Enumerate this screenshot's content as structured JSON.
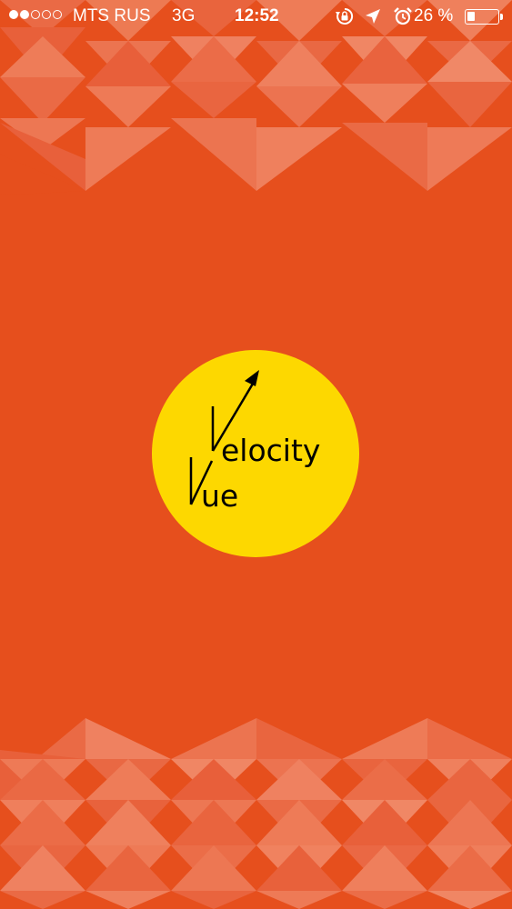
{
  "status_bar": {
    "signal_bars_filled": 2,
    "signal_bars_total": 5,
    "carrier": "MTS RUS",
    "network": "3G",
    "time": "12:52",
    "icons": [
      "rotation-lock-icon",
      "location-arrow-icon",
      "alarm-icon"
    ],
    "battery_percent_label": "26 %",
    "battery_level": 0.26
  },
  "splash": {
    "logo": {
      "word_1": "elocity",
      "word_2": "ue"
    }
  },
  "colors": {
    "background": "#e64f1d",
    "logo_circle": "#fdd800",
    "logo_ink": "#000000",
    "status_text": "#ffffff"
  }
}
